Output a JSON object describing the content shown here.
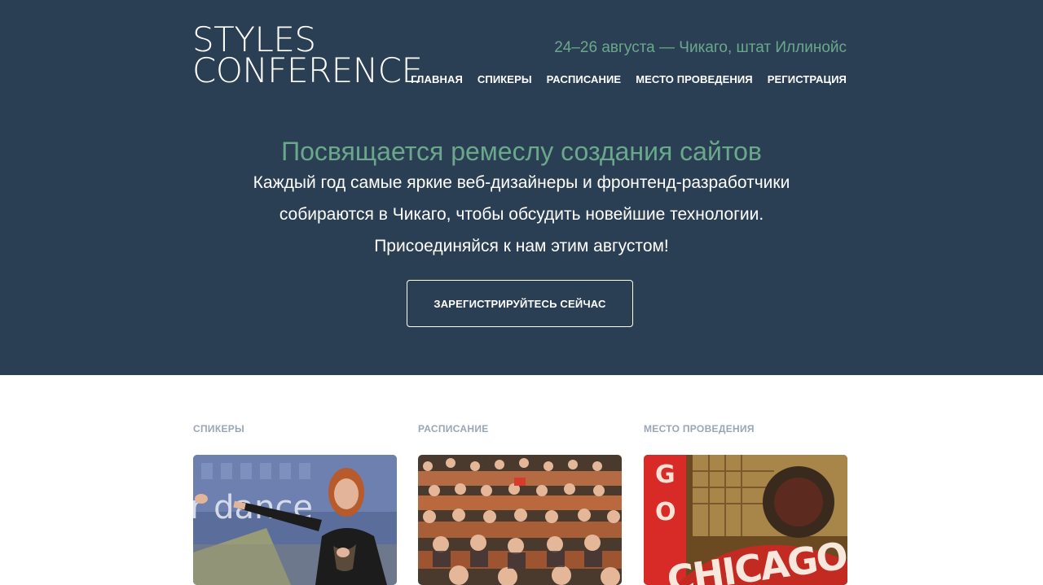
{
  "header": {
    "logo_line1": "STYLES",
    "logo_line2": "CONFERENCE",
    "tagline": "24–26 августа — Чикаго, штат Иллинойс",
    "nav": [
      {
        "label": "ГЛАВНАЯ"
      },
      {
        "label": "СПИКЕРЫ"
      },
      {
        "label": "РАСПИСАНИЕ"
      },
      {
        "label": "МЕСТО ПРОВЕДЕНИЯ"
      },
      {
        "label": "РЕГИСТРАЦИЯ"
      }
    ]
  },
  "hero": {
    "title": "Посвящается ремеслу создания сайтов",
    "lines": [
      "Каждый год самые яркие веб-дизайнеры и фронтенд-разработчики",
      "собираются в Чикаго, чтобы обсудить новейшие технологии.",
      "Присоединяйся к нам этим августом!"
    ],
    "cta_label": "ЗАРЕГИСТРИРУЙТЕСЬ СЕЙЧАС"
  },
  "sections": [
    {
      "label": "СПИКЕРЫ",
      "image": "speaker-photo"
    },
    {
      "label": "РАСПИСАНИЕ",
      "image": "audience-photo"
    },
    {
      "label": "МЕСТО ПРОВЕДЕНИЯ",
      "image": "chicago-theatre-sign-photo"
    }
  ],
  "colors": {
    "hero_bg": "#2b3f54",
    "accent_green": "#6aa88c",
    "section_label": "#9aa7b3"
  }
}
